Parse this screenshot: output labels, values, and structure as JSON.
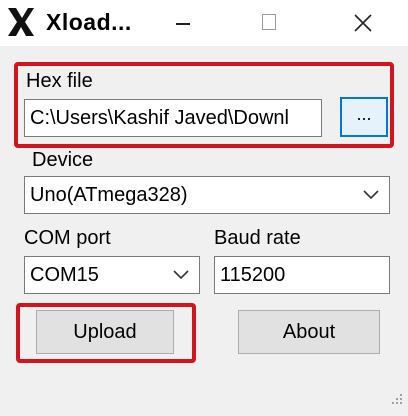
{
  "window": {
    "title": "Xload...",
    "icon": "x-logo-icon"
  },
  "window_controls": [
    "minimize-icon",
    "maximize-icon",
    "close-icon"
  ],
  "hex_file": {
    "label": "Hex file",
    "path_value": "C:\\Users\\Kashif Javed\\Downl",
    "browse_label": "..."
  },
  "device": {
    "label": "Device",
    "selected": "Uno(ATmega328)"
  },
  "com_port": {
    "label": "COM port",
    "selected": "COM15"
  },
  "baud_rate": {
    "label": "Baud rate",
    "value": "115200"
  },
  "buttons": {
    "upload_label": "Upload",
    "about_label": "About"
  },
  "colors": {
    "highlight": "#d4141c",
    "focus_border": "#0078d7"
  }
}
